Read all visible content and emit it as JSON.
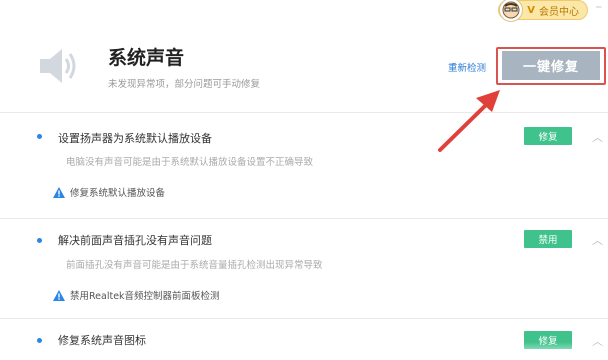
{
  "member": {
    "label": "会员中心",
    "vip": "V"
  },
  "header": {
    "title": "系统声音",
    "subtitle": "未发现异常项，部分问题可手动修复",
    "recheck_label": "重新检测",
    "fix_all_label": "一键修复"
  },
  "items": [
    {
      "title": "设置扬声器为系统默认播放设备",
      "desc": "电脑没有声音可能是由于系统默认播放设备设置不正确导致",
      "action": "修复系统默认播放设备",
      "badge": "修复"
    },
    {
      "title": "解决前面声音插孔没有声音问题",
      "desc": "前面插孔没有声音可能是由于系统音量插孔检测出现异常导致",
      "action": "禁用Realtek音频控制器前面板检测",
      "badge": "禁用"
    },
    {
      "title": "修复系统声音图标",
      "desc": "",
      "action": "",
      "badge": "修复"
    }
  ],
  "colors": {
    "accent_blue": "#2b86e6",
    "badge_green": "#3fc28c",
    "fix_button_gray": "#a8b4c0",
    "highlight_red": "#d9534f"
  }
}
